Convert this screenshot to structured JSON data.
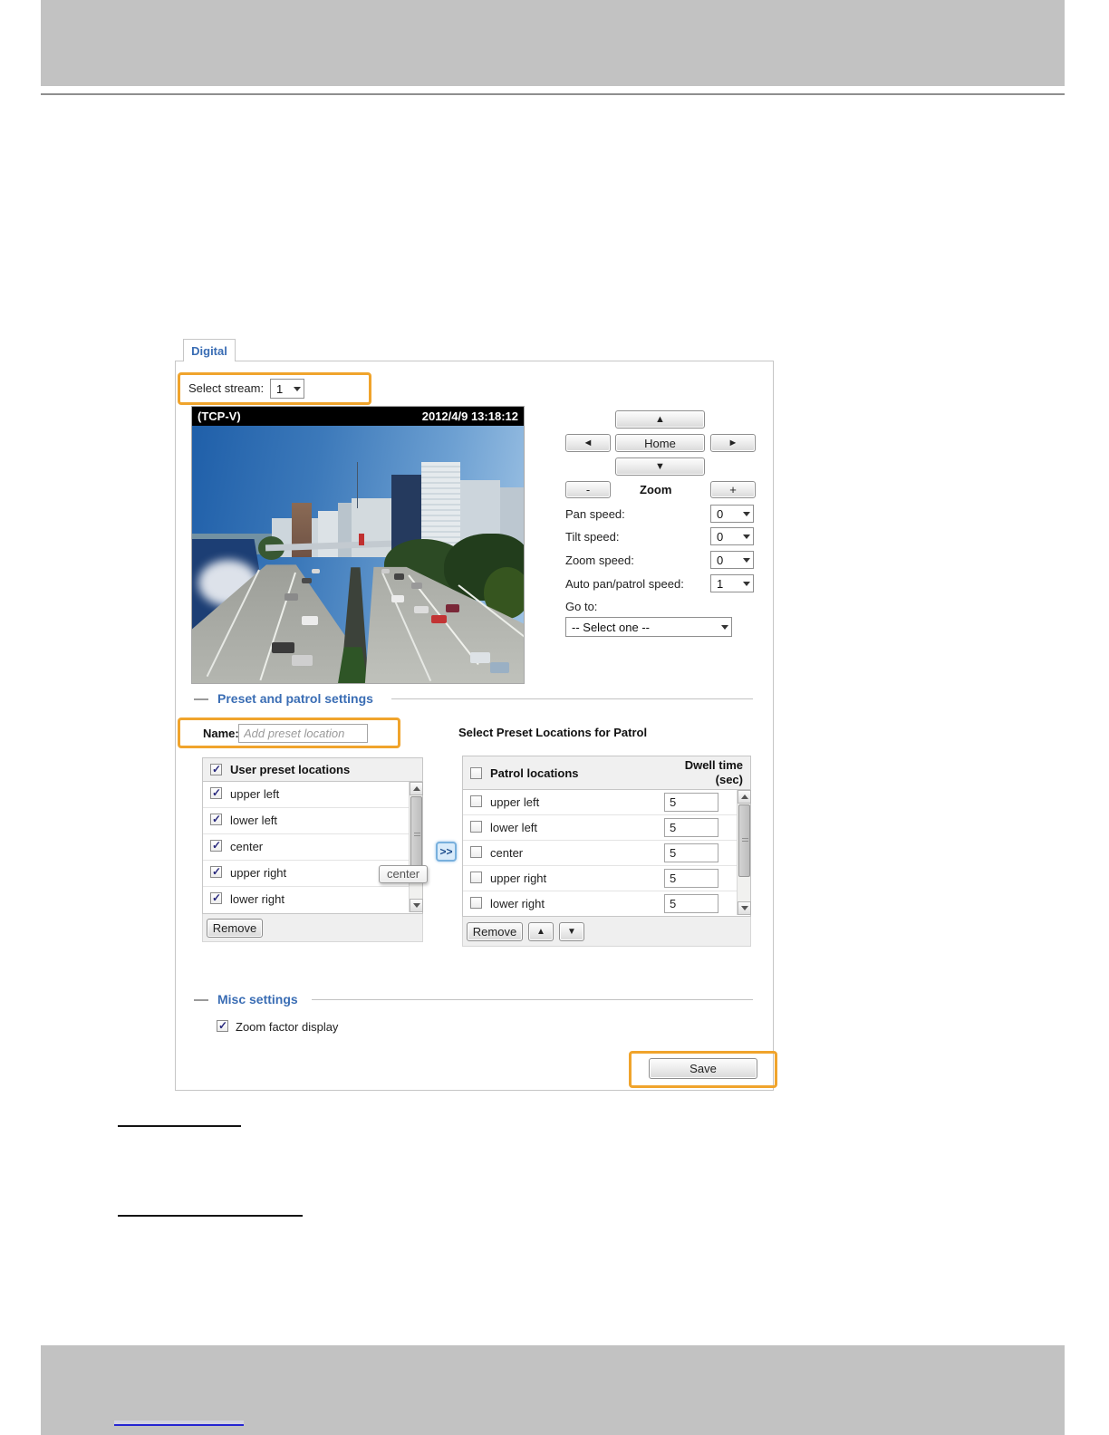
{
  "tab": {
    "label": "Digital"
  },
  "stream": {
    "label": "Select stream:",
    "value": "1"
  },
  "video": {
    "protocol": "(TCP-V)",
    "timestamp": "2012/4/9 13:18:12"
  },
  "ptz": {
    "up": "▲",
    "down": "▼",
    "left": "◄",
    "right": "►",
    "home": "Home",
    "zoom_label": "Zoom",
    "zoom_out": "-",
    "zoom_in": "+",
    "speeds": [
      {
        "label": "Pan speed:",
        "value": "0"
      },
      {
        "label": "Tilt speed:",
        "value": "0"
      },
      {
        "label": "Zoom speed:",
        "value": "0"
      },
      {
        "label": "Auto pan/patrol speed:",
        "value": "1"
      }
    ],
    "goto_label": "Go to:",
    "goto_value": "-- Select one --"
  },
  "preset_section": {
    "title": "Preset and patrol settings",
    "name_label": "Name:",
    "name_placeholder": "Add preset location",
    "patrol_caption": "Select Preset Locations for Patrol",
    "transfer_button": ">>",
    "tooltip": "center",
    "user_list": {
      "header": "User preset locations",
      "items": [
        "upper left",
        "lower left",
        "center",
        "upper right",
        "lower right"
      ],
      "remove_label": "Remove"
    },
    "patrol_list": {
      "header": "Patrol locations",
      "dwell_header": "Dwell time",
      "dwell_unit": "(sec)",
      "items": [
        {
          "name": "upper left",
          "dwell": "5"
        },
        {
          "name": "lower left",
          "dwell": "5"
        },
        {
          "name": "center",
          "dwell": "5"
        },
        {
          "name": "upper right",
          "dwell": "5"
        },
        {
          "name": "lower right",
          "dwell": "5"
        }
      ],
      "remove_label": "Remove",
      "up_label": "▲",
      "down_label": "▼"
    }
  },
  "misc_section": {
    "title": "Misc settings",
    "zoom_factor_label": "Zoom factor display"
  },
  "save_button": "Save",
  "colors": {
    "accent_orange": "#f0a42c",
    "title_blue": "#3a6db4",
    "link_blue": "#2525d2",
    "band_gray": "#c2c2c2"
  }
}
